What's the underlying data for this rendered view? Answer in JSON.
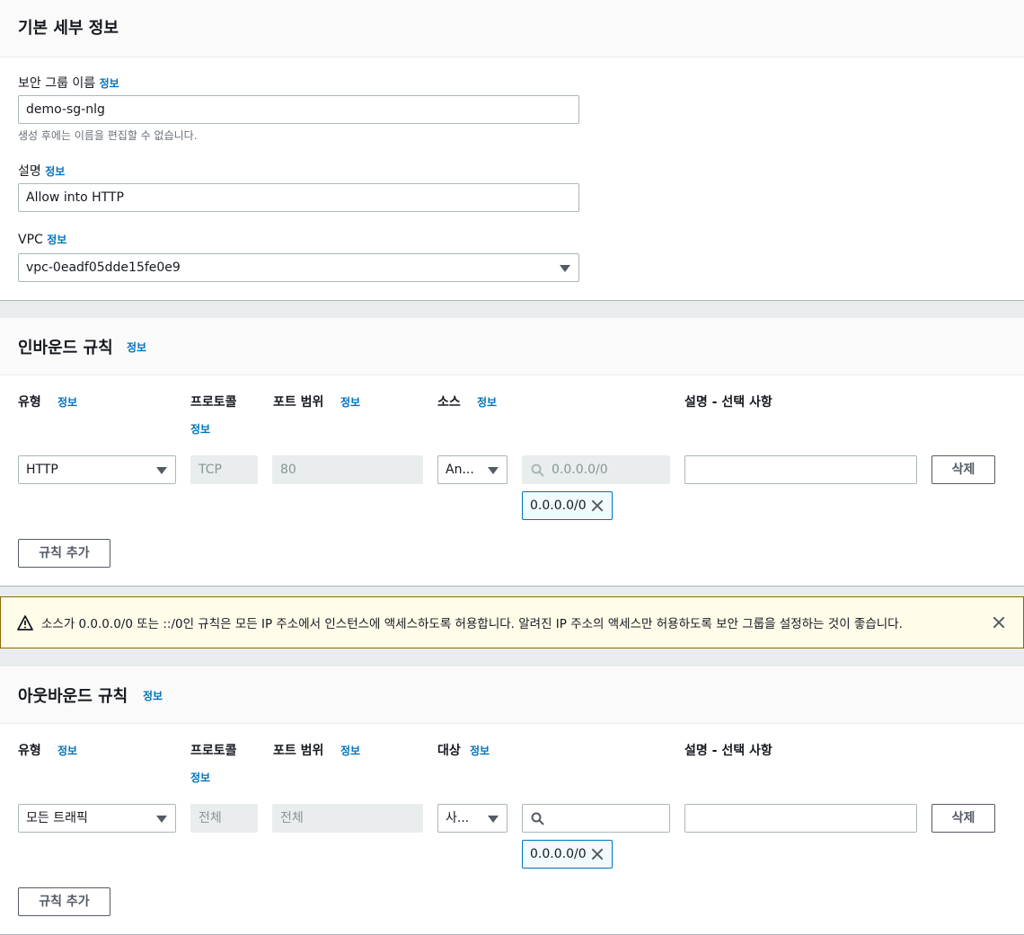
{
  "basic": {
    "title": "기본 세부 정보",
    "sg_name_label": "보안 그룹 이름",
    "sg_name_info": "정보",
    "sg_name_value": "demo-sg-nlg",
    "sg_name_hint": "생성 후에는 이름을 편집할 수 없습니다.",
    "desc_label": "설명",
    "desc_info": "정보",
    "desc_value": "Allow into HTTP",
    "vpc_label": "VPC",
    "vpc_info": "정보",
    "vpc_value": "vpc-0eadf05dde15fe0e9"
  },
  "inbound": {
    "title": "인바운드 규칙",
    "title_info": "정보",
    "col_type": "유형",
    "col_type_info": "정보",
    "col_protocol": "프로토콜",
    "col_protocol_info": "정보",
    "col_port": "포트 범위",
    "col_port_info": "정보",
    "col_source": "소스",
    "col_source_info": "정보",
    "col_desc": "설명 - 선택 사항",
    "rule": {
      "type": "HTTP",
      "protocol": "TCP",
      "port": "80",
      "source_select": "An...",
      "source_search_placeholder": "0.0.0.0/0",
      "token": "0.0.0.0/0",
      "description": "",
      "delete": "삭제"
    },
    "add_rule": "규칙 추가"
  },
  "warning": {
    "text": "소스가 0.0.0.0/0 또는 ::/0인 규칙은 모든 IP 주소에서 인스턴스에 액세스하도록 허용합니다. 알려진 IP 주소의 액세스만 허용하도록 보안 그룹을 설정하는 것이 좋습니다."
  },
  "outbound": {
    "title": "아웃바운드 규칙",
    "title_info": "정보",
    "col_type": "유형",
    "col_type_info": "정보",
    "col_protocol": "프로토콜",
    "col_protocol_info": "정보",
    "col_port": "포트 범위",
    "col_port_info": "정보",
    "col_dest": "대상",
    "col_dest_info": "정보",
    "col_desc": "설명 - 선택 사항",
    "rule": {
      "type": "모든 트래픽",
      "protocol": "전체",
      "port": "전체",
      "dest_select": "사...",
      "dest_search_placeholder": "",
      "token": "0.0.0.0/0",
      "description": "",
      "delete": "삭제"
    },
    "add_rule": "규칙 추가"
  },
  "colors": {
    "link": "#0073bb",
    "warning_bg": "#fffce9",
    "warning_border": "#906806",
    "token_border": "#0073bb"
  }
}
